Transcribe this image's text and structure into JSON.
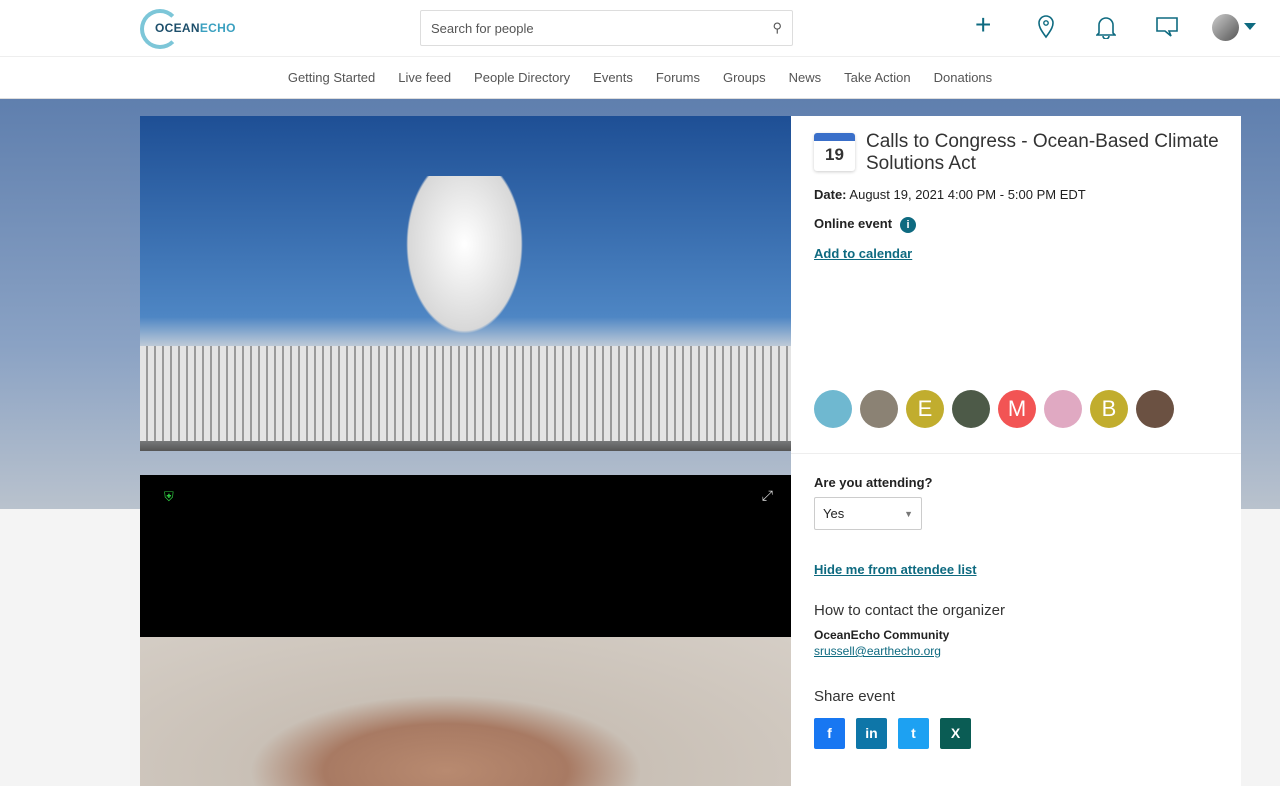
{
  "header": {
    "logo_main": "OCEAN",
    "logo_accent": "ECHO",
    "search_placeholder": "Search for people"
  },
  "nav": [
    "Getting Started",
    "Live feed",
    "People Directory",
    "Events",
    "Forums",
    "Groups",
    "News",
    "Take Action",
    "Donations"
  ],
  "event": {
    "day": "19",
    "title": "Calls to Congress - Ocean-Based Climate Solutions Act",
    "date_label": "Date:",
    "date": "August 19, 2021 4:00 PM - 5:00 PM EDT",
    "online": "Online event",
    "add_calendar": "Add to calendar",
    "attendees": [
      {
        "initial": "",
        "color": "#6fb8d0"
      },
      {
        "initial": "",
        "color": "#8b8274"
      },
      {
        "initial": "E",
        "color": "#c1ad2e"
      },
      {
        "initial": "",
        "color": "#4d5a48"
      },
      {
        "initial": "M",
        "color": "#f25454"
      },
      {
        "initial": "",
        "color": "#e0a9c2"
      },
      {
        "initial": "B",
        "color": "#c1ad2e"
      },
      {
        "initial": "",
        "color": "#6b5142"
      }
    ]
  },
  "rsvp": {
    "question": "Are you attending?",
    "value": "Yes",
    "hide": "Hide me from attendee list"
  },
  "organizer": {
    "heading": "How to contact the organizer",
    "name": "OceanEcho Community",
    "email": "srussell@earthecho.org"
  },
  "share": {
    "heading": "Share event",
    "buttons": [
      {
        "icon": "f",
        "color": "#1877f2"
      },
      {
        "icon": "in",
        "color": "#0e76a8"
      },
      {
        "icon": "t",
        "color": "#1da1f2"
      },
      {
        "icon": "X",
        "color": "#0a5c54"
      }
    ]
  }
}
